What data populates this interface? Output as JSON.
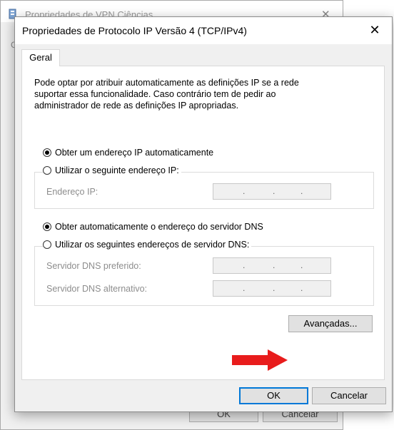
{
  "background_window": {
    "title": "Propriedades de VPN Ciências",
    "tab_letter": "G",
    "ok_label": "OK",
    "cancel_label": "Cancelar"
  },
  "dialog": {
    "title": "Propriedades de Protocolo IP Versão 4 (TCP/IPv4)",
    "close_glyph": "✕",
    "tab_label": "Geral",
    "description": "Pode optar por atribuir automaticamente as definições IP se a rede suportar essa funcionalidade. Caso contrário tem de pedir ao administrador de rede as definições IP apropriadas.",
    "ip": {
      "auto_label": "Obter um endereço IP automaticamente",
      "auto_selected": true,
      "manual_label": "Utilizar o seguinte endereço IP:",
      "address_label": "Endereço IP:",
      "address_value": ". . ."
    },
    "dns": {
      "auto_label": "Obter automaticamente o endereço do servidor DNS",
      "auto_selected": true,
      "manual_label": "Utilizar os seguintes endereços de servidor DNS:",
      "preferred_label": "Servidor DNS preferido:",
      "alternate_label": "Servidor DNS alternativo:"
    },
    "advanced_label": "Avançadas...",
    "ok_label": "OK",
    "cancel_label": "Cancelar"
  },
  "annotation": {
    "arrow_color": "#e81c1c",
    "accent": "#0078d7"
  }
}
